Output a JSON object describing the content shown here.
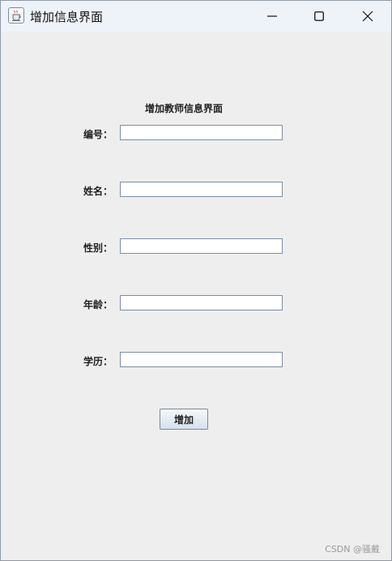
{
  "window": {
    "title": "增加信息界面",
    "app_icon": "java-cup-icon",
    "controls": {
      "minimize": "minimize-icon",
      "maximize": "maximize-icon",
      "close": "close-icon"
    }
  },
  "form": {
    "heading": "增加教师信息界面",
    "fields": [
      {
        "label": "编号：",
        "value": ""
      },
      {
        "label": "姓名：",
        "value": ""
      },
      {
        "label": "性别：",
        "value": ""
      },
      {
        "label": "年龄：",
        "value": ""
      },
      {
        "label": "学历：",
        "value": ""
      }
    ],
    "submit_label": "增加"
  },
  "watermark": "CSDN @骚戴"
}
